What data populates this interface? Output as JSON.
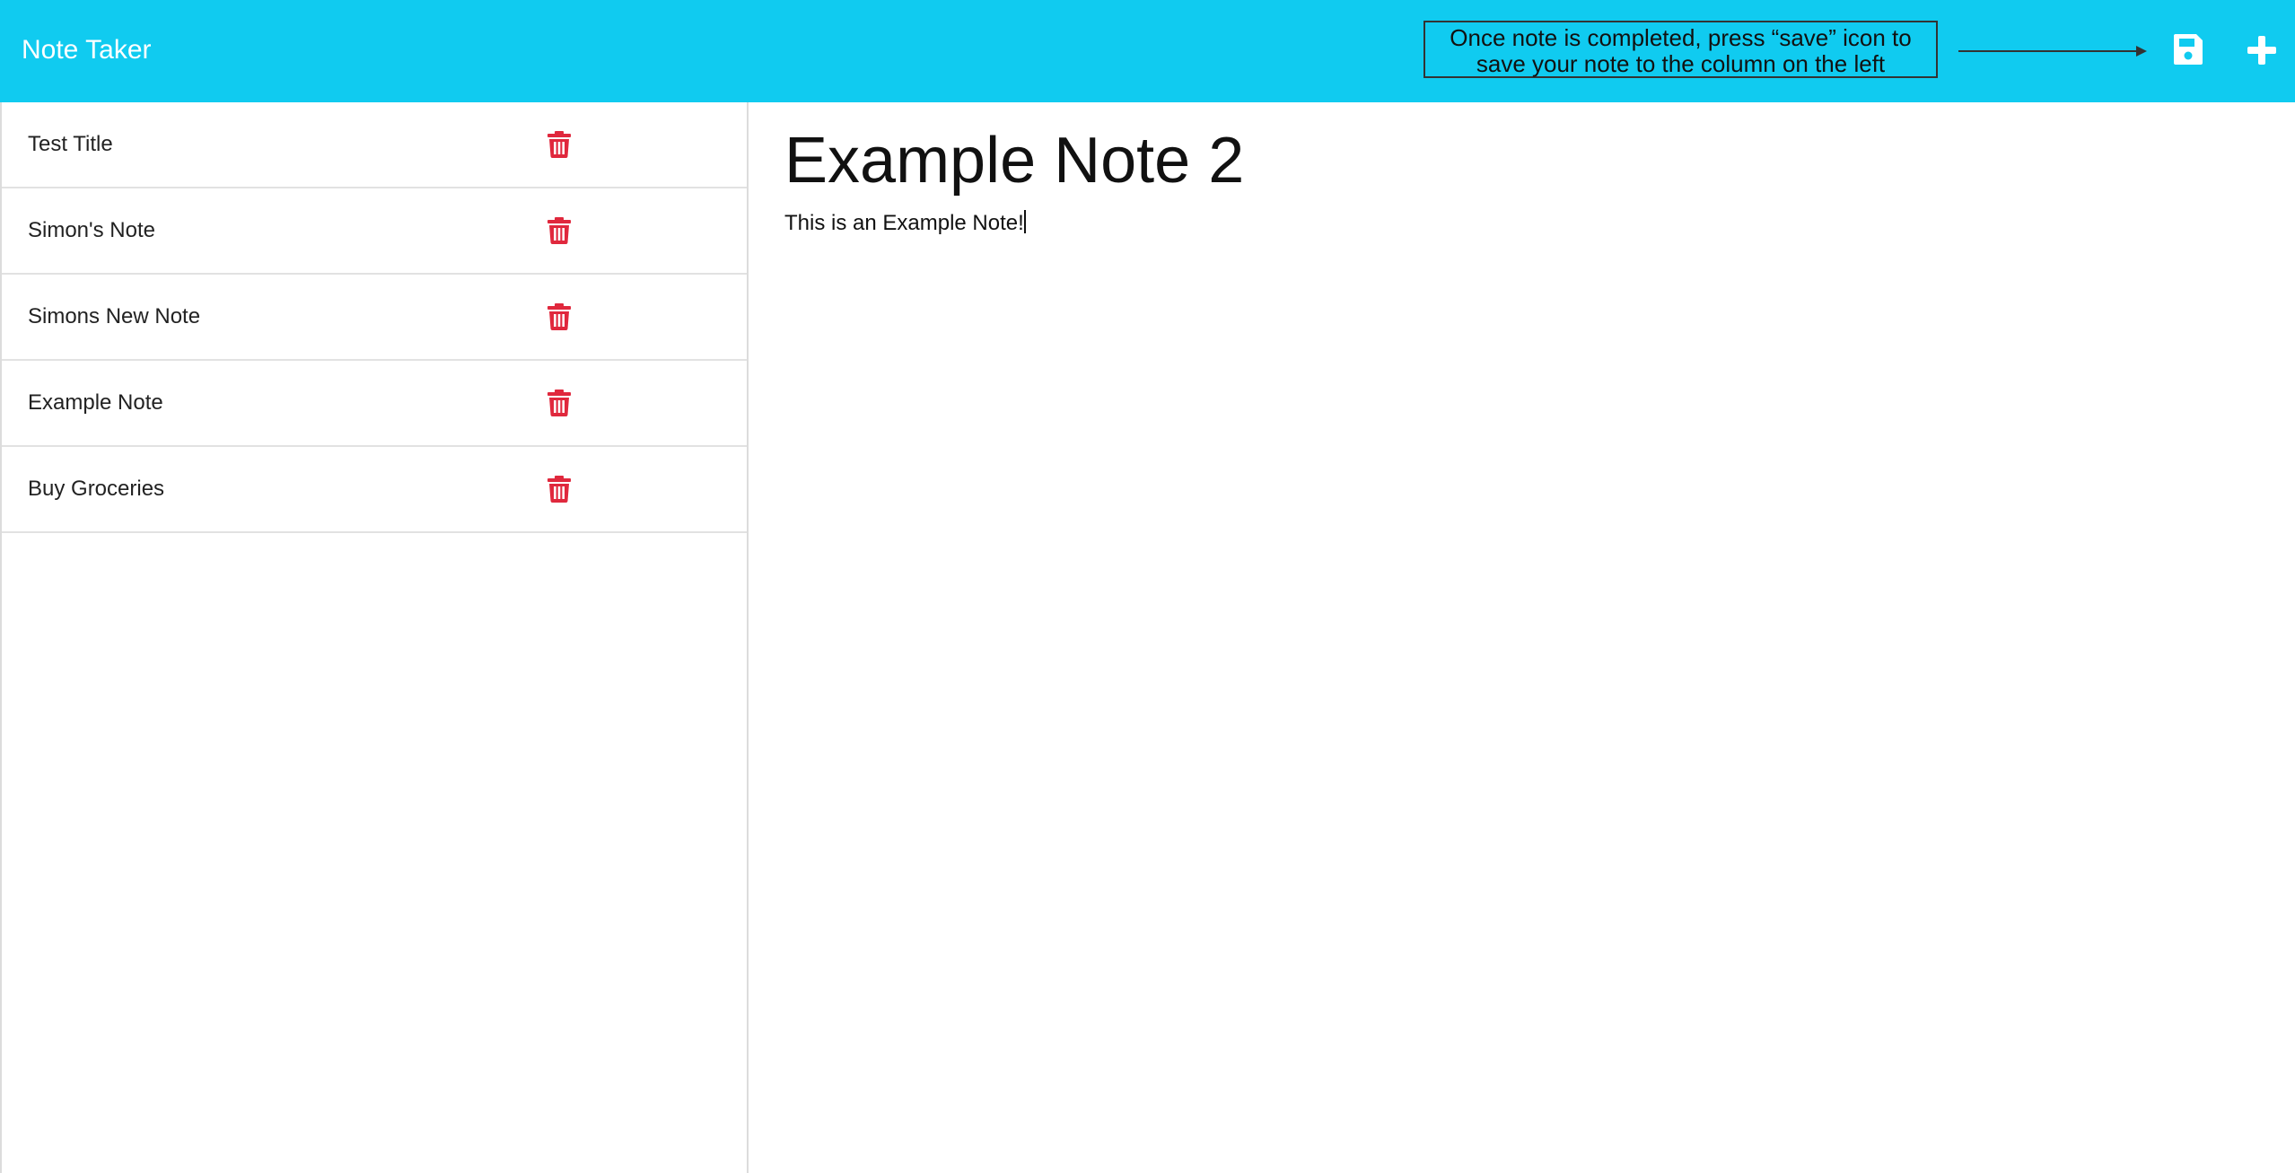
{
  "app": {
    "title": "Note Taker"
  },
  "toolbar": {
    "annotation_text": "Once note is completed, press “save” icon to save your note to the column on the left",
    "save_icon": "save-icon",
    "new_icon": "plus-icon"
  },
  "sidebar": {
    "items": [
      {
        "title": "Test Title",
        "icon": "trash-icon"
      },
      {
        "title": "Simon's Note",
        "icon": "trash-icon"
      },
      {
        "title": "Simons New Note",
        "icon": "trash-icon"
      },
      {
        "title": "Example Note",
        "icon": "trash-icon"
      },
      {
        "title": "Buy Groceries",
        "icon": "trash-icon"
      }
    ]
  },
  "editor": {
    "title": "Example Note 2",
    "text": "This is an Example Note!"
  },
  "colors": {
    "navbar": "#10cbf0",
    "delete": "#e0283d",
    "brand_text": "#ffffff"
  }
}
